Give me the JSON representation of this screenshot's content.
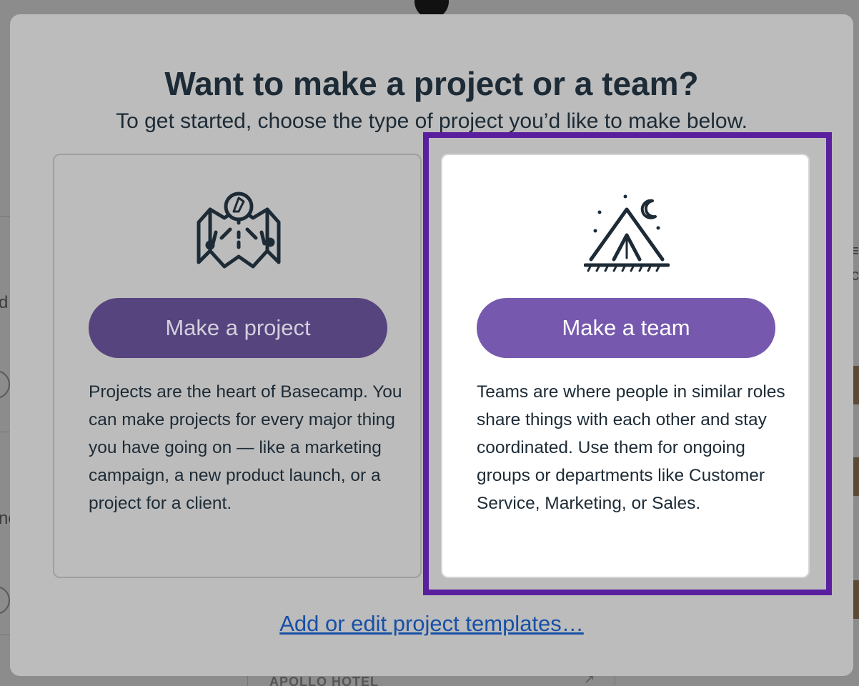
{
  "modal": {
    "title": "Want to make a project or a team?",
    "subtitle": "To get started, choose the type of project you’d like to make below.",
    "project_card": {
      "icon": "map-compass-icon",
      "button_label": "Make a project",
      "description": "Projects are the heart of Basecamp. You can make projects for every major thing you have going on — like a marketing campaign, a new product launch, or a project for a client."
    },
    "team_card": {
      "icon": "tent-night-icon",
      "button_label": "Make a team",
      "description": "Teams are where people in similar roles share things with each other and stay coordinated. Use them for ongoing groups or departments like Customer Service, Marketing, or Sales.",
      "highlighted": true
    },
    "templates_link": "Add or edit project templates…"
  },
  "background": {
    "card_title": "APOLLO HOTEL",
    "left_glyph_1": "d",
    "left_glyph_2": "ne",
    "right_glyph_1": "≡",
    "right_glyph_2": "c"
  },
  "colors": {
    "overlay": "#8e8e8e",
    "modal_bg": "#bcbcbc",
    "heading": "#1d2b36",
    "project_button": "#56447e",
    "team_button": "#7659ae",
    "highlight_border": "#5a1f9e",
    "link": "#1750a6"
  }
}
